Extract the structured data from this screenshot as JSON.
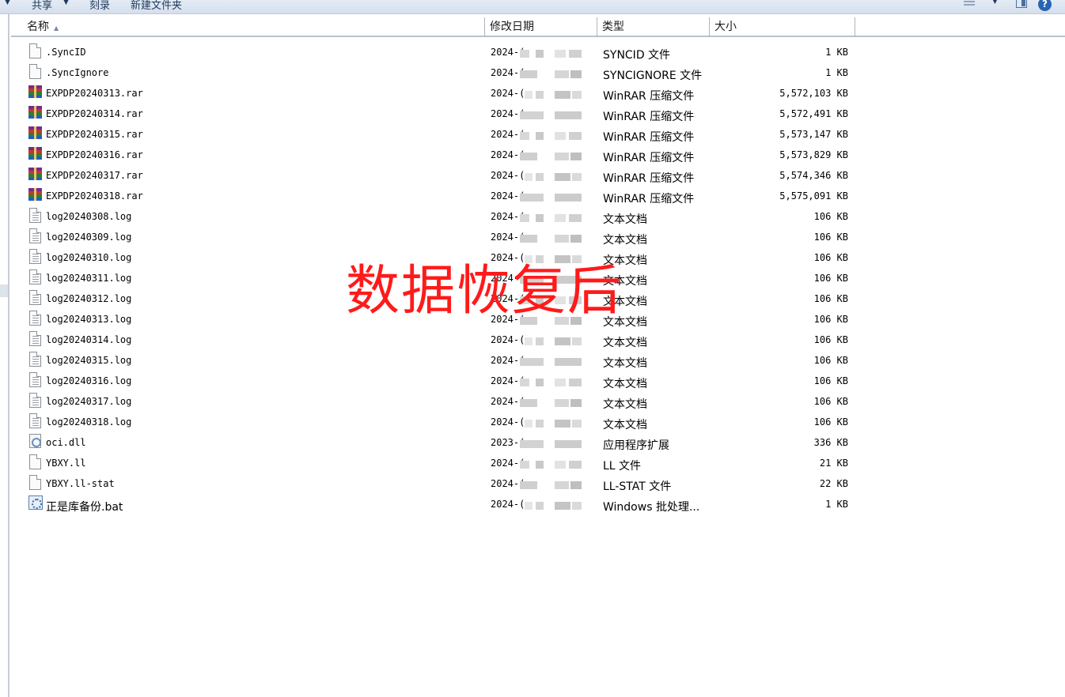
{
  "toolbar": {
    "share": "共享",
    "burn": "刻录",
    "new_folder": "新建文件夹",
    "help": "?"
  },
  "columns": {
    "name": "名称",
    "date": "修改日期",
    "type": "类型",
    "size": "大小"
  },
  "files": [
    {
      "name": ".SyncID",
      "date": "2024-(",
      "type": "SYNCID 文件",
      "size": "1 KB",
      "icon": "document-icon"
    },
    {
      "name": ".SyncIgnore",
      "date": "2024-(",
      "type": "SYNCIGNORE 文件",
      "size": "1 KB",
      "icon": "document-icon"
    },
    {
      "name": "EXPDP20240313.rar",
      "date": "2024-(",
      "type": "WinRAR 压缩文件",
      "size": "5,572,103 KB",
      "icon": "winrar-icon"
    },
    {
      "name": "EXPDP20240314.rar",
      "date": "2024-(",
      "type": "WinRAR 压缩文件",
      "size": "5,572,491 KB",
      "icon": "winrar-icon"
    },
    {
      "name": "EXPDP20240315.rar",
      "date": "2024-(",
      "type": "WinRAR 压缩文件",
      "size": "5,573,147 KB",
      "icon": "winrar-icon"
    },
    {
      "name": "EXPDP20240316.rar",
      "date": "2024-(",
      "type": "WinRAR 压缩文件",
      "size": "5,573,829 KB",
      "icon": "winrar-icon"
    },
    {
      "name": "EXPDP20240317.rar",
      "date": "2024-(",
      "type": "WinRAR 压缩文件",
      "size": "5,574,346 KB",
      "icon": "winrar-icon"
    },
    {
      "name": "EXPDP20240318.rar",
      "date": "2024-(",
      "type": "WinRAR 压缩文件",
      "size": "5,575,091 KB",
      "icon": "winrar-icon"
    },
    {
      "name": "log20240308.log",
      "date": "2024-(",
      "type": "文本文档",
      "size": "106 KB",
      "icon": "text-file-icon"
    },
    {
      "name": "log20240309.log",
      "date": "2024-(",
      "type": "文本文档",
      "size": "106 KB",
      "icon": "text-file-icon"
    },
    {
      "name": "log20240310.log",
      "date": "2024-(",
      "type": "文本文档",
      "size": "106 KB",
      "icon": "text-file-icon"
    },
    {
      "name": "log20240311.log",
      "date": "2024-(",
      "type": "文本文档",
      "size": "106 KB",
      "icon": "text-file-icon"
    },
    {
      "name": "log20240312.log",
      "date": "2024-(",
      "type": "文本文档",
      "size": "106 KB",
      "icon": "text-file-icon"
    },
    {
      "name": "log20240313.log",
      "date": "2024-(",
      "type": "文本文档",
      "size": "106 KB",
      "icon": "text-file-icon"
    },
    {
      "name": "log20240314.log",
      "date": "2024-(",
      "type": "文本文档",
      "size": "106 KB",
      "icon": "text-file-icon"
    },
    {
      "name": "log20240315.log",
      "date": "2024-(",
      "type": "文本文档",
      "size": "106 KB",
      "icon": "text-file-icon"
    },
    {
      "name": "log20240316.log",
      "date": "2024-(",
      "type": "文本文档",
      "size": "106 KB",
      "icon": "text-file-icon"
    },
    {
      "name": "log20240317.log",
      "date": "2024-(",
      "type": "文本文档",
      "size": "106 KB",
      "icon": "text-file-icon"
    },
    {
      "name": "log20240318.log",
      "date": "2024-(",
      "type": "文本文档",
      "size": "106 KB",
      "icon": "text-file-icon"
    },
    {
      "name": "oci.dll",
      "date": "2023-(",
      "type": "应用程序扩展",
      "size": "336 KB",
      "icon": "dll-icon"
    },
    {
      "name": "YBXY.ll",
      "date": "2024-(",
      "type": "LL 文件",
      "size": "21 KB",
      "icon": "document-icon"
    },
    {
      "name": "YBXY.ll-stat",
      "date": "2024-(",
      "type": "LL-STAT 文件",
      "size": "22 KB",
      "icon": "document-icon"
    },
    {
      "name": "正是库备份.bat",
      "date": "2024-(",
      "type": "Windows 批处理...",
      "size": "1 KB",
      "icon": "batch-file-icon"
    }
  ],
  "watermark": "数据恢复后",
  "colors": {
    "watermark": "#ff1a1a",
    "toolbar_text": "#1e395b"
  }
}
